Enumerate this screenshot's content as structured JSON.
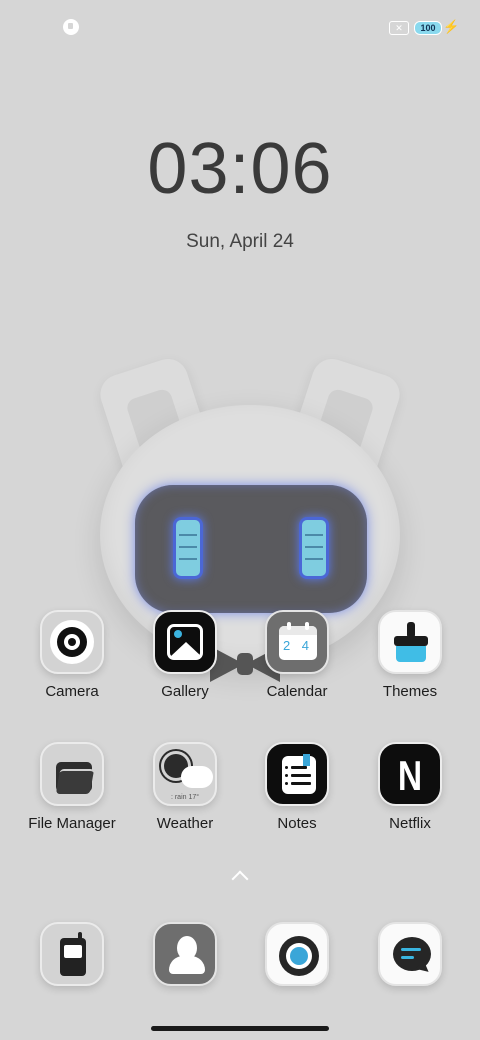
{
  "status_bar": {
    "sim_glyph": "✕",
    "battery_level": "100",
    "charging_icon": "bolt-icon"
  },
  "lockscreen": {
    "time": "03:06",
    "date": "Sun, April 24"
  },
  "apps_row1": [
    {
      "label": "Camera",
      "icon": "camera-icon"
    },
    {
      "label": "Gallery",
      "icon": "gallery-icon"
    },
    {
      "label": "Calendar",
      "icon": "calendar-icon"
    },
    {
      "label": "Themes",
      "icon": "themes-icon"
    }
  ],
  "apps_row2": [
    {
      "label": "File Manager",
      "icon": "folder-icon"
    },
    {
      "label": "Weather",
      "icon": "weather-icon"
    },
    {
      "label": "Notes",
      "icon": "notes-icon"
    },
    {
      "label": "Netflix",
      "icon": "netflix-icon"
    }
  ],
  "calendar_icon_text": "2 4",
  "weather_icon_text": ": rain 17°",
  "netflix_icon_text": "N",
  "dock": [
    {
      "name": "Phone",
      "icon": "phone-icon"
    },
    {
      "name": "Contacts",
      "icon": "contacts-icon"
    },
    {
      "name": "Browser",
      "icon": "browser-icon"
    },
    {
      "name": "Messages",
      "icon": "messages-icon"
    }
  ],
  "colors": {
    "wallpaper": "#d6d6d6",
    "accent": "#3aa6d8",
    "robot_eye": "#7fcde0"
  }
}
